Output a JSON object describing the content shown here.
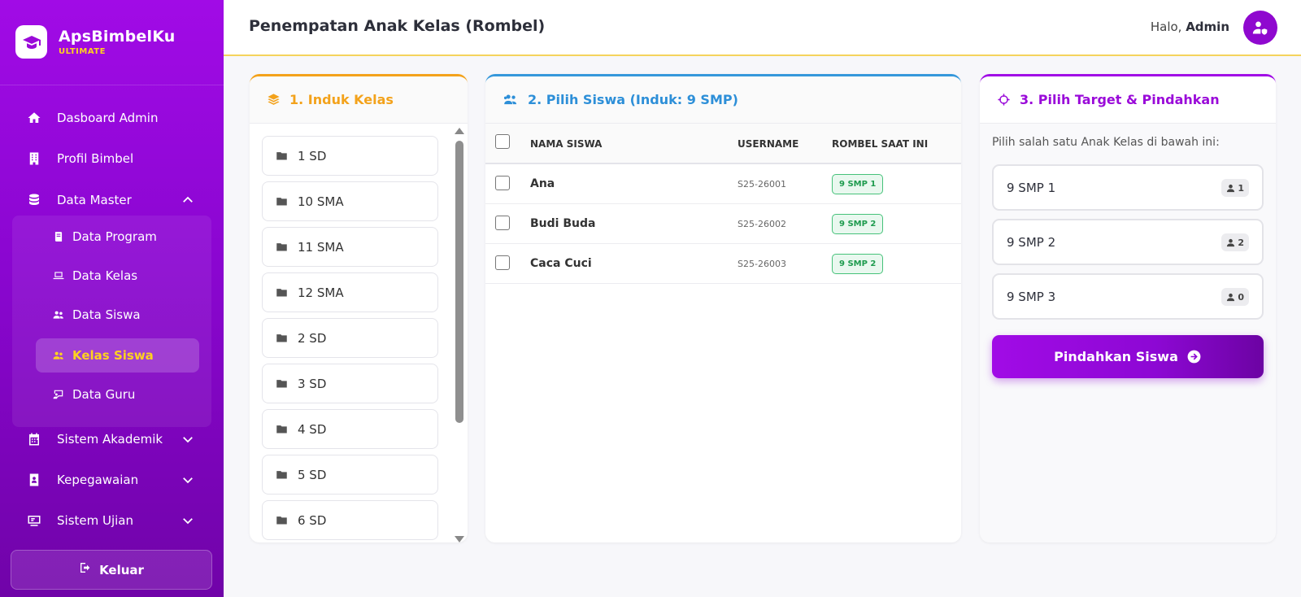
{
  "brand": {
    "name": "ApsBimbelKu",
    "sub": "ULTIMATE"
  },
  "sidebar": {
    "items": [
      {
        "label": "Dasboard Admin",
        "icon": "home-icon"
      },
      {
        "label": "Profil Bimbel",
        "icon": "building-icon"
      },
      {
        "label": "Data Master",
        "icon": "database-icon",
        "expanded": true
      },
      {
        "label": "Sistem Akademik",
        "icon": "calendar-icon"
      },
      {
        "label": "Kepegawaian",
        "icon": "id-card-icon"
      },
      {
        "label": "Sistem Ujian",
        "icon": "monitor-icon"
      }
    ],
    "sub_items": [
      {
        "label": "Data Program",
        "icon": "book-icon"
      },
      {
        "label": "Data Kelas",
        "icon": "laptop-icon"
      },
      {
        "label": "Data Siswa",
        "icon": "users-icon"
      },
      {
        "label": "Kelas Siswa",
        "icon": "users-icon",
        "active": true
      },
      {
        "label": "Data Guru",
        "icon": "chalkboard-icon"
      }
    ],
    "logout_label": "Keluar"
  },
  "header": {
    "title": "Penempatan Anak Kelas (Rombel)",
    "greeting_prefix": "Halo, ",
    "greeting_name": "Admin"
  },
  "panel1": {
    "title": "1. Induk Kelas",
    "classes": [
      "1 SD",
      "10 SMA",
      "11 SMA",
      "12 SMA",
      "2 SD",
      "3 SD",
      "4 SD",
      "5 SD",
      "6 SD"
    ]
  },
  "panel2": {
    "title": "2. Pilih Siswa (Induk: 9 SMP)",
    "columns": {
      "name": "NAMA SISWA",
      "username": "USERNAME",
      "rombel": "ROMBEL SAAT INI"
    },
    "rows": [
      {
        "name": "Ana",
        "username": "S25-26001",
        "rombel": "9 SMP 1"
      },
      {
        "name": "Budi Buda",
        "username": "S25-26002",
        "rombel": "9 SMP 2"
      },
      {
        "name": "Caca Cuci",
        "username": "S25-26003",
        "rombel": "9 SMP 2"
      }
    ]
  },
  "panel3": {
    "title": "3. Pilih Target & Pindahkan",
    "hint": "Pilih salah satu Anak Kelas di bawah ini:",
    "targets": [
      {
        "label": "9 SMP 1",
        "count": "1"
      },
      {
        "label": "9 SMP 2",
        "count": "2"
      },
      {
        "label": "9 SMP 3",
        "count": "0"
      }
    ],
    "button_label": "Pindahkan Siswa"
  },
  "colors": {
    "brand_purple": "#a10be6",
    "active_yellow": "#ffd21f",
    "panel1_accent": "#f3a21b",
    "panel2_accent": "#2d8fd8",
    "badge_green": "#1e9b4e"
  }
}
